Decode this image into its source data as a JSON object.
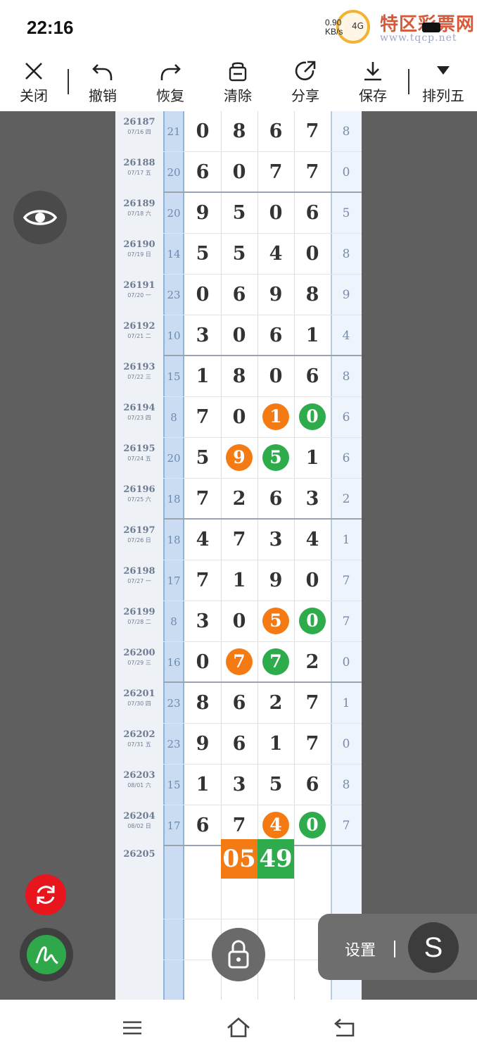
{
  "status": {
    "time": "22:16",
    "net_speed": "0.90",
    "net_unit": "KB/s",
    "net_type": "4G",
    "watermark_title": "特区彩票网",
    "watermark_url": "www.tqcp.net"
  },
  "toolbar": {
    "close": "关闭",
    "undo": "撤销",
    "redo": "恢复",
    "clear": "清除",
    "share": "分享",
    "save": "保存",
    "game": "排列五"
  },
  "rows": [
    {
      "issue": "26187",
      "date": "07/16 四",
      "sum": "21",
      "d": [
        "0",
        "8",
        "6",
        "7"
      ],
      "tail": "8",
      "thick": false
    },
    {
      "issue": "26188",
      "date": "07/17 五",
      "sum": "20",
      "d": [
        "6",
        "0",
        "7",
        "7"
      ],
      "tail": "0",
      "thick": true
    },
    {
      "issue": "26189",
      "date": "07/18 六",
      "sum": "20",
      "d": [
        "9",
        "5",
        "0",
        "6"
      ],
      "tail": "5",
      "thick": false
    },
    {
      "issue": "26190",
      "date": "07/19 日",
      "sum": "14",
      "d": [
        "5",
        "5",
        "4",
        "0"
      ],
      "tail": "8",
      "thick": false
    },
    {
      "issue": "26191",
      "date": "07/20 一",
      "sum": "23",
      "d": [
        "0",
        "6",
        "9",
        "8"
      ],
      "tail": "9",
      "thick": false
    },
    {
      "issue": "26192",
      "date": "07/21 二",
      "sum": "10",
      "d": [
        "3",
        "0",
        "6",
        "1"
      ],
      "tail": "4",
      "thick": true
    },
    {
      "issue": "26193",
      "date": "07/22 三",
      "sum": "15",
      "d": [
        "1",
        "8",
        "0",
        "6"
      ],
      "tail": "8",
      "thick": false
    },
    {
      "issue": "26194",
      "date": "07/23 四",
      "sum": "8",
      "d": [
        "7",
        "0",
        "1",
        "0"
      ],
      "tail": "6",
      "balls": [
        null,
        null,
        "o",
        "g"
      ],
      "thick": false
    },
    {
      "issue": "26195",
      "date": "07/24 五",
      "sum": "20",
      "d": [
        "5",
        "9",
        "5",
        "1"
      ],
      "tail": "6",
      "balls": [
        null,
        "o",
        "g",
        null
      ],
      "thick": false
    },
    {
      "issue": "26196",
      "date": "07/25 六",
      "sum": "18",
      "d": [
        "7",
        "2",
        "6",
        "3"
      ],
      "tail": "2",
      "thick": true
    },
    {
      "issue": "26197",
      "date": "07/26 日",
      "sum": "18",
      "d": [
        "4",
        "7",
        "3",
        "4"
      ],
      "tail": "1",
      "thick": false
    },
    {
      "issue": "26198",
      "date": "07/27 一",
      "sum": "17",
      "d": [
        "7",
        "1",
        "9",
        "0"
      ],
      "tail": "7",
      "thick": false
    },
    {
      "issue": "26199",
      "date": "07/28 二",
      "sum": "8",
      "d": [
        "3",
        "0",
        "5",
        "0"
      ],
      "tail": "7",
      "balls": [
        null,
        null,
        "o",
        "g"
      ],
      "thick": false
    },
    {
      "issue": "26200",
      "date": "07/29 三",
      "sum": "16",
      "d": [
        "0",
        "7",
        "7",
        "2"
      ],
      "tail": "0",
      "balls": [
        null,
        "o",
        "g",
        null
      ],
      "thick": true
    },
    {
      "issue": "26201",
      "date": "07/30 四",
      "sum": "23",
      "d": [
        "8",
        "6",
        "2",
        "7"
      ],
      "tail": "1",
      "thick": false
    },
    {
      "issue": "26202",
      "date": "07/31 五",
      "sum": "23",
      "d": [
        "9",
        "6",
        "1",
        "7"
      ],
      "tail": "0",
      "thick": false
    },
    {
      "issue": "26203",
      "date": "08/01 六",
      "sum": "15",
      "d": [
        "1",
        "3",
        "5",
        "6"
      ],
      "tail": "8",
      "thick": false
    },
    {
      "issue": "26204",
      "date": "08/02 日",
      "sum": "17",
      "d": [
        "6",
        "7",
        "4",
        "0"
      ],
      "tail": "7",
      "balls": [
        null,
        null,
        "o",
        "g"
      ],
      "thick": true
    }
  ],
  "pending": {
    "issue": "26205",
    "orange": "05",
    "green": "49"
  },
  "settings": {
    "label": "设置",
    "s_label": "S"
  },
  "colors": {
    "orange": "#f47a14",
    "green": "#2eac4b",
    "red": "#e8151c",
    "blue_col": "#c9dcf2"
  }
}
